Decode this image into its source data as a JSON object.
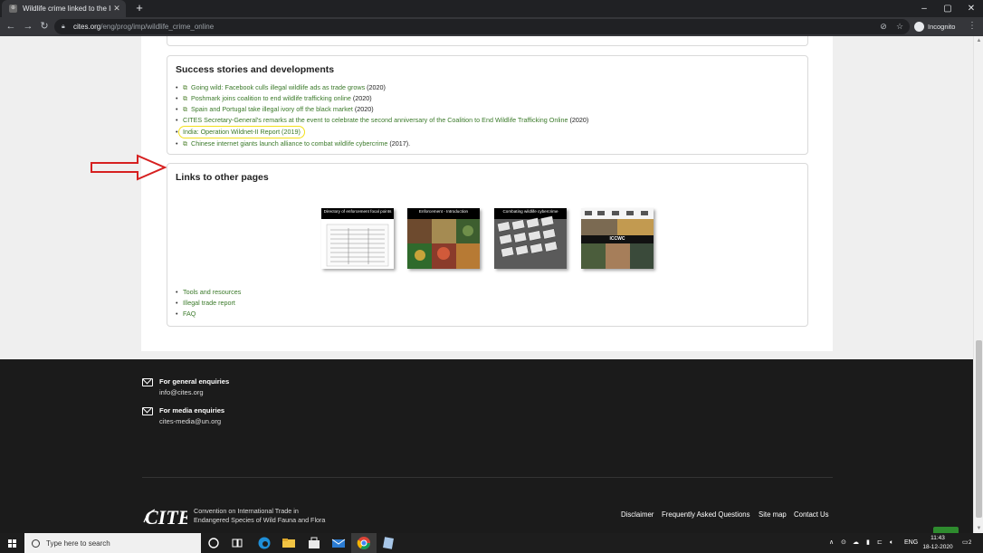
{
  "browser": {
    "tab_title": "Wildlife crime linked to the Inter",
    "tab_close": "✕",
    "new_tab": "+",
    "url_domain": "cites.org",
    "url_path": "/eng/prog/imp/wildlife_crime_online",
    "incognito_label": "Incognito",
    "window_controls": [
      "–",
      "▢",
      "✕"
    ]
  },
  "stories": {
    "heading": "Success stories and developments",
    "items": [
      {
        "text": "Going wild: Facebook culls illegal wildlife ads as trade grows",
        "year": " (2020)"
      },
      {
        "text": "Poshmark joins coalition to end wildlife trafficking online",
        "year": " (2020)"
      },
      {
        "text": "Spain and Portugal take illegal ivory off the black market",
        "year": " (2020)"
      },
      {
        "text": "CITES Secretary-General's remarks at the event to celebrate the second anniversary of the Coalition to End Wildlife Trafficking Online",
        "year": " (2020)"
      },
      {
        "text": "India: Operation Wildnet-II Report (2019)",
        "year": ""
      },
      {
        "text": "Chinese internet giants launch alliance to combat wildlife cybercrime",
        "year": " (2017)."
      }
    ]
  },
  "links": {
    "heading": "Links to other pages",
    "thumbnails": [
      {
        "title": "Directory of enforcement focal points"
      },
      {
        "title": "Enforcement - Introduction"
      },
      {
        "title": "Combating wildlife cybercrime"
      },
      {
        "title": "ICCWC"
      }
    ],
    "items": [
      "Tools and resources",
      "Illegal trade report",
      "FAQ"
    ]
  },
  "footer": {
    "general_title": "For general enquiries",
    "general_email": "info@cites.org",
    "media_title": "For media enquiries",
    "media_email": "cites-media@un.org",
    "convention_line1": "Convention on International Trade in",
    "convention_line2": "Endangered Species of Wild Fauna and Flora",
    "links": [
      "Disclaimer",
      "Frequently Asked Questions",
      "Site map",
      "Contact Us"
    ]
  },
  "taskbar": {
    "search_placeholder": "Type here to search",
    "language": "ENG",
    "time": "11:43",
    "date": "18-12-2020",
    "notification_count": "2"
  },
  "colors": {
    "link_green": "#3b7a2a",
    "highlight_yellow": "#f3e01a",
    "arrow_red": "#d62020",
    "footer_bg": "#1b1b1b",
    "back_to_top": "#2e8b2e"
  }
}
